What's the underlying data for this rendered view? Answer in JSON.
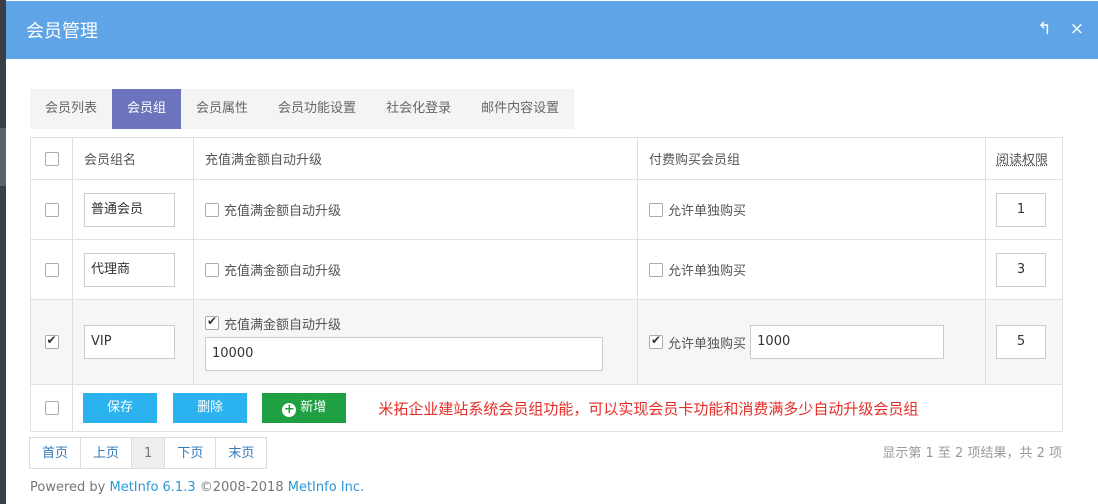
{
  "header": {
    "title": "会员管理",
    "back_icon": "↰",
    "close_icon": "×"
  },
  "tabs": [
    "会员列表",
    "会员组",
    "会员属性",
    "会员功能设置",
    "社会化登录",
    "邮件内容设置"
  ],
  "columns": {
    "name": "会员组名",
    "upgrade": "充值满金额自动升级",
    "pay": "付费购买会员组",
    "read": "阅读权限"
  },
  "rows": [
    {
      "name": "普通会员",
      "upgrade_label": "充值满金额自动升级",
      "pay_label": "允许单独购买",
      "read": "1"
    },
    {
      "name": "代理商",
      "upgrade_label": "充值满金额自动升级",
      "pay_label": "允许单独购买",
      "read": "3"
    },
    {
      "name": "VIP",
      "upgrade_label": "充值满金额自动升级",
      "upgrade_amount": "10000",
      "pay_label": "允许单独购买",
      "pay_amount": "1000",
      "read": "5"
    }
  ],
  "actions": {
    "save": "保存",
    "delete": "删除",
    "add": "新增",
    "note": "米拓企业建站系统会员组功能，可以实现会员卡功能和消费满多少自动升级会员组"
  },
  "pager": {
    "first": "首页",
    "prev": "上页",
    "current": "1",
    "next": "下页",
    "last": "末页",
    "info": "显示第 1 至 2 项结果，共 2 项"
  },
  "footer": {
    "prefix": "Powered by ",
    "product": "MetInfo 6.1.3",
    "copyright": " ©2008-2018 ",
    "company": "MetInfo Inc."
  },
  "colors": {
    "header": "#5fa4e6",
    "active_tab": "#6d74bd",
    "save_button": "#2bb3f0",
    "add_button": "#1fa043",
    "note": "#e52d27"
  }
}
